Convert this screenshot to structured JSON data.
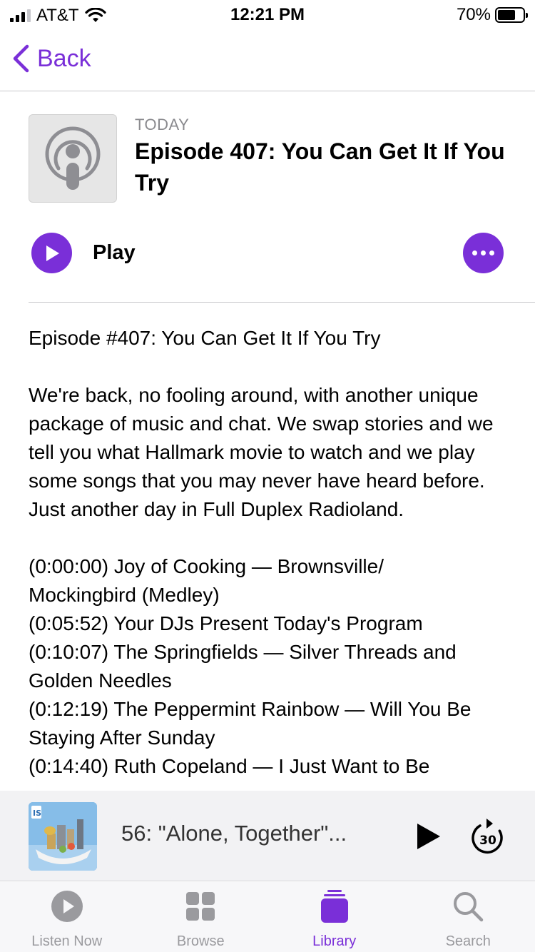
{
  "status_bar": {
    "carrier": "AT&T",
    "time": "12:21 PM",
    "battery": "70%",
    "battery_level": 0.7
  },
  "nav": {
    "back_label": "Back"
  },
  "episode": {
    "date": "TODAY",
    "title": "Episode 407: You Can Get It If You Try",
    "play_label": "Play",
    "description": [
      "Episode #407: You Can Get It If You Try",
      "We're back, no fooling around, with another unique package of music and chat. We swap stories and we tell you what Hallmark movie to watch and we play some songs that you may never have heard before. Just another day in Full Duplex Radioland.",
      "(0:00:00) Joy of Cooking — Brownsville/\nMockingbird (Medley)\n(0:05:52) Your DJs Present Today's Program\n(0:10:07) The Springfields — Silver Threads and Golden Needles\n(0:12:19) The Peppermint Rainbow — Will You Be Staying After Sunday\n(0:14:40) Ruth Copeland — I Just Want to Be"
    ]
  },
  "mini_player": {
    "title": "56: \"Alone, Together\"...",
    "art_text": "IS ISRAEL STORY",
    "skip_seconds": "30"
  },
  "tabs": [
    {
      "label": "Listen Now",
      "icon": "play-circle-icon"
    },
    {
      "label": "Browse",
      "icon": "grid-icon"
    },
    {
      "label": "Library",
      "icon": "library-stack-icon",
      "active": true
    },
    {
      "label": "Search",
      "icon": "magnifier-icon"
    }
  ],
  "colors": {
    "accent": "#7a2fd8",
    "inactive": "#9a9a9e"
  }
}
